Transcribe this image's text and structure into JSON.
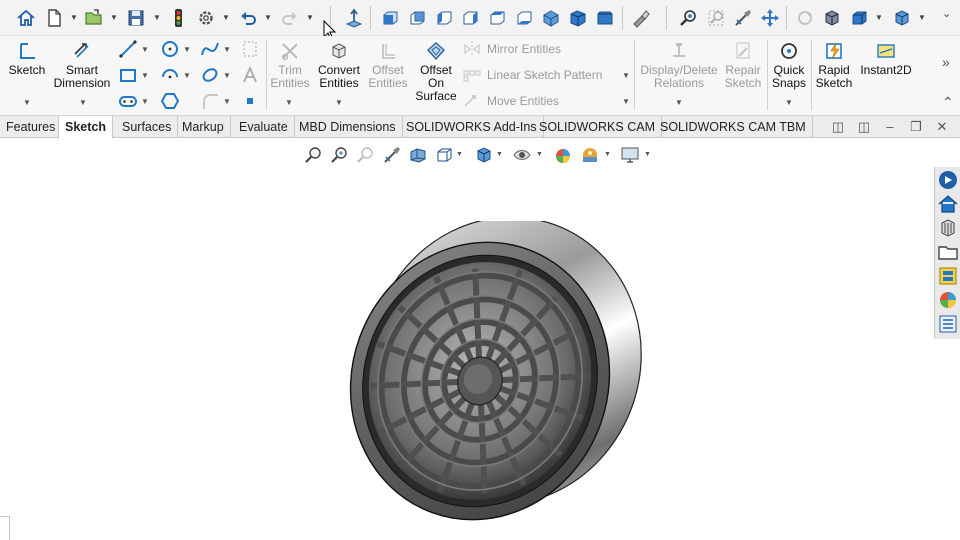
{
  "ribbon": {
    "sketch": "Sketch",
    "smart_dimension_1": "Smart",
    "smart_dimension_2": "Dimension",
    "trim_1": "Trim",
    "trim_2": "Entities",
    "convert_1": "Convert",
    "convert_2": "Entities",
    "offset_1": "Offset",
    "offset_2": "Entities",
    "offset_surface_1": "Offset",
    "offset_surface_2": "On",
    "offset_surface_3": "Surface",
    "mirror": "Mirror Entities",
    "linear_pattern": "Linear Sketch Pattern",
    "move": "Move Entities",
    "display_delete_1": "Display/Delete",
    "display_delete_2": "Relations",
    "repair_1": "Repair",
    "repair_2": "Sketch",
    "quick_snaps_1": "Quick",
    "quick_snaps_2": "Snaps",
    "rapid_sketch_1": "Rapid",
    "rapid_sketch_2": "Sketch",
    "instant2d": "Instant2D"
  },
  "tabs": [
    {
      "label": "Features"
    },
    {
      "label": "Sketch",
      "active": true
    },
    {
      "label": "Surfaces"
    },
    {
      "label": "Markup"
    },
    {
      "label": "Evaluate"
    },
    {
      "label": "MBD Dimensions"
    },
    {
      "label": "SOLIDWORKS Add-Ins"
    },
    {
      "label": "SOLIDWORKS CAM"
    },
    {
      "label": "SOLIDWORKS CAM TBM"
    }
  ],
  "icons": {
    "home": "home-icon",
    "new": "new-document-icon",
    "open": "open-icon",
    "save": "save-icon",
    "rebuild": "traffic-light-icon",
    "options": "gear-icon",
    "undo": "undo-icon",
    "redo": "redo-icon"
  },
  "colors": {
    "accent_blue": "#1f78c8",
    "tab_bar": "#ececec",
    "ribbon_bg": "#f7f7f7",
    "disabled_text": "#9a9a9a"
  }
}
